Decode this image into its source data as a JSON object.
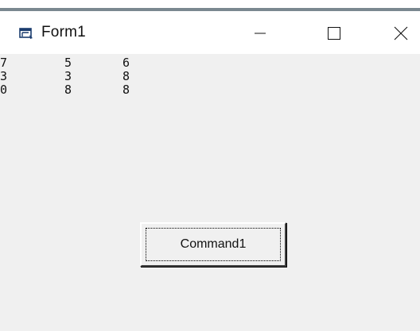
{
  "window": {
    "title": "Form1",
    "icon": "form-icon",
    "controls": {
      "minimize": "minimize-icon",
      "maximize": "maximize-icon",
      "close": "close-icon"
    }
  },
  "output_grid": {
    "rows": [
      [
        "7",
        "5",
        "6"
      ],
      [
        "3",
        "3",
        "8"
      ],
      [
        "0",
        "8",
        "8"
      ]
    ]
  },
  "command_button": {
    "label": "Command1"
  },
  "colors": {
    "client_background": "#f0f0f0",
    "titlebar_background": "#ffffff",
    "border_accent": "#7a8890"
  }
}
